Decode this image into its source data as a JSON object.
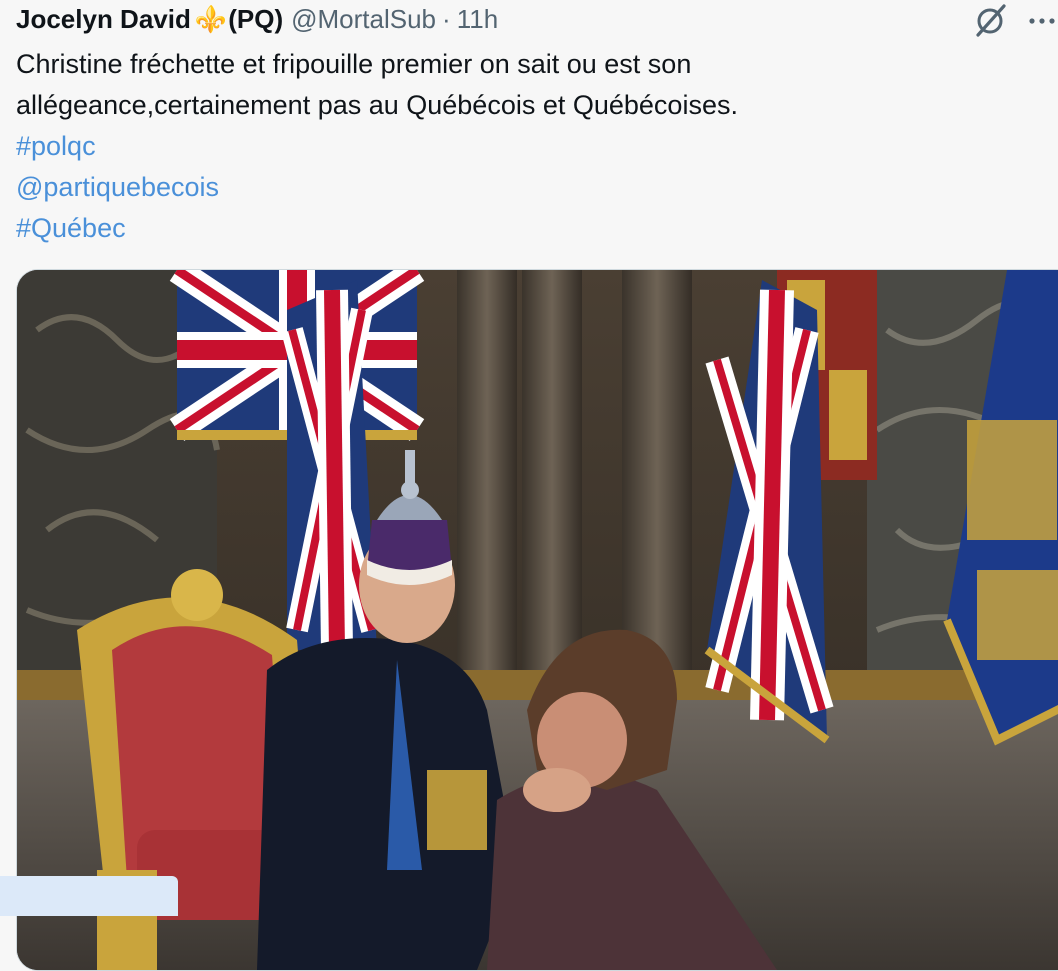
{
  "author": {
    "name": "Jocelyn David",
    "emoji": "⚜️",
    "party": "(PQ)",
    "handle": "@MortalSub",
    "separator": "·",
    "time": "11h"
  },
  "tweet": {
    "line1": "Christine fréchette et fripouille premier on sait ou est son",
    "line2": "allégeance,certainement pas au Québécois et Québécoises.",
    "hashtag1": "#polqc",
    "mention": "@partiquebecois",
    "hashtag2": "#Québec"
  },
  "icons": {
    "grok": "grok-icon",
    "more": "more-options-icon",
    "fleur": "fleur-de-lis-icon"
  },
  "colors": {
    "link": "#4a90d9",
    "muted": "#536471",
    "fleur": "#7b3fa0"
  }
}
